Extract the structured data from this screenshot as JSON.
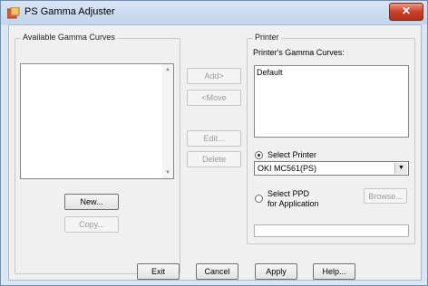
{
  "window": {
    "title": "PS Gamma Adjuster",
    "close_glyph": "✕"
  },
  "available": {
    "legend": "Available Gamma Curves",
    "items": [],
    "new_label": "New...",
    "copy_label": "Copy..."
  },
  "middle": {
    "add_label": "Add>",
    "move_label": "<Move",
    "edit_label": "Edit...",
    "delete_label": "Delete"
  },
  "printer": {
    "legend": "Printer",
    "curves_label": "Printer's Gamma Curves:",
    "curves": [
      "Default"
    ],
    "select_printer_label": "Select Printer",
    "printer_value": "OKI MC561(PS)",
    "select_ppd_label_line1": "Select PPD",
    "select_ppd_label_line2": "for Application",
    "browse_label": "Browse...",
    "ppd_path": ""
  },
  "footer": {
    "exit_label": "Exit",
    "cancel_label": "Cancel",
    "apply_label": "Apply",
    "help_label": "Help..."
  }
}
